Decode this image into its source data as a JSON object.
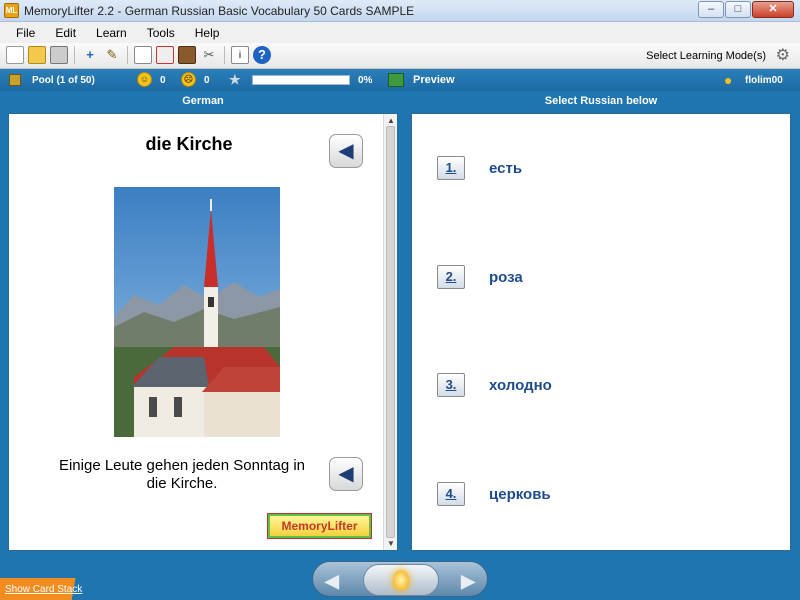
{
  "window": {
    "title": "MemoryLifter 2.2 - German Russian Basic Vocabulary 50 Cards SAMPLE",
    "app_icon_text": "ML",
    "minimize": "–",
    "maximize": "□",
    "close": "✕"
  },
  "menu": [
    "File",
    "Edit",
    "Learn",
    "Tools",
    "Help"
  ],
  "toolbar": {
    "icons": [
      "new-icon",
      "open-icon",
      "print-icon",
      "add-card-icon",
      "edit-icon",
      "presentation-icon",
      "card-stack-icon",
      "dictionary-icon",
      "tools-icon",
      "info-icon",
      "help-icon"
    ],
    "mode_label": "Select Learning Mode(s)"
  },
  "status": {
    "pool_label": "Pool   (1 of 50)",
    "count_correct": "0",
    "count_wrong": "0",
    "progress_fraction": 0,
    "progress_label": "0%",
    "preview_label": "Preview",
    "user_name": "flolim00"
  },
  "question": {
    "header": "German",
    "word": "die Kirche",
    "sentence": "Einige Leute gehen jeden Sonntag in die Kirche.",
    "logo_text": "MemoryLifter"
  },
  "answers": {
    "header": "Select Russian below",
    "items": [
      {
        "key": "1.",
        "text": "есть"
      },
      {
        "key": "2.",
        "text": "роза"
      },
      {
        "key": "3.",
        "text": "холодно"
      },
      {
        "key": "4.",
        "text": "церковь"
      }
    ]
  },
  "bottom": {
    "show_stack_label": "Show Card Stack"
  },
  "colors": {
    "accent_blue": "#1e75b0",
    "answer_text": "#1e4c8a",
    "stack_tab": "#f28c1e"
  }
}
